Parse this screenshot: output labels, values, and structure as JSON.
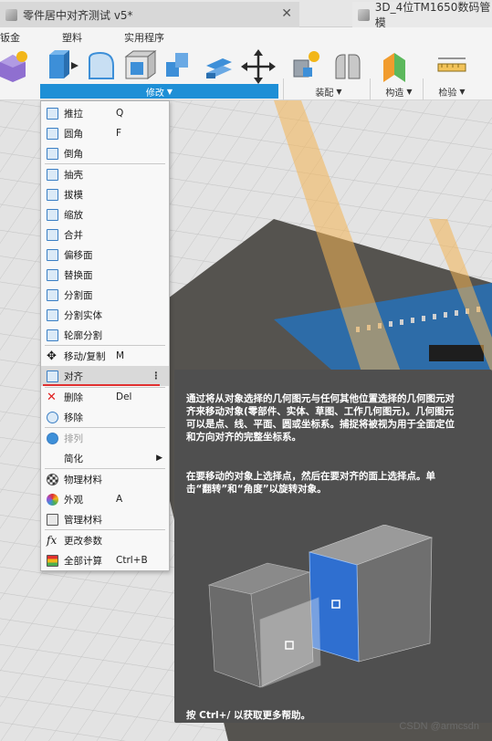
{
  "tabs": [
    {
      "title": "零件居中对齐测试 v5*"
    },
    {
      "title": "3D_4位TM1650数码管模"
    }
  ],
  "ribbon": {
    "tabs": [
      "钣金",
      "塑料",
      "实用程序"
    ],
    "groups": {
      "modify": "修改",
      "assemble": "装配",
      "construct": "构造",
      "inspect": "检验"
    }
  },
  "menu": {
    "items": [
      {
        "label": "推拉",
        "shortcut": "Q"
      },
      {
        "label": "圆角",
        "shortcut": "F"
      },
      {
        "label": "倒角",
        "shortcut": ""
      },
      {
        "label": "抽壳",
        "shortcut": ""
      },
      {
        "label": "拔模",
        "shortcut": ""
      },
      {
        "label": "缩放",
        "shortcut": ""
      },
      {
        "label": "合并",
        "shortcut": ""
      },
      {
        "label": "偏移面",
        "shortcut": ""
      },
      {
        "label": "替换面",
        "shortcut": ""
      },
      {
        "label": "分割面",
        "shortcut": ""
      },
      {
        "label": "分割实体",
        "shortcut": ""
      },
      {
        "label": "轮廓分割",
        "shortcut": ""
      },
      {
        "label": "移动/复制",
        "shortcut": "M"
      },
      {
        "label": "对齐",
        "shortcut": ""
      },
      {
        "label": "删除",
        "shortcut": "Del"
      },
      {
        "label": "移除",
        "shortcut": ""
      },
      {
        "label": "排列",
        "shortcut": ""
      },
      {
        "label": "简化",
        "shortcut": ""
      },
      {
        "label": "物理材料",
        "shortcut": ""
      },
      {
        "label": "外观",
        "shortcut": "A"
      },
      {
        "label": "管理材料",
        "shortcut": ""
      },
      {
        "label": "更改参数",
        "shortcut": ""
      },
      {
        "label": "全部计算",
        "shortcut": "Ctrl+B"
      }
    ]
  },
  "tooltip": {
    "p1": "通过将从对象选择的几何图元与任何其他位置选择的几何图元对齐来移动对象(零部件、实体、草图、工作几何图元)。几何图元可以是点、线、平面、圆或坐标系。捕捉将被视为用于全面定位和方向对齐的完整坐标系。",
    "p2": "在要移动的对象上选择点，然后在要对齐的面上选择点。单击“翻转”和“角度”以旋转对象。",
    "help": "按 Ctrl+/ 以获取更多帮助。"
  },
  "watermark": "CSDN @armcsdn",
  "colors": {
    "accent": "#1e8fd6",
    "tooltip_bg": "#4f4f4f",
    "highlight_line": "#e03030"
  }
}
